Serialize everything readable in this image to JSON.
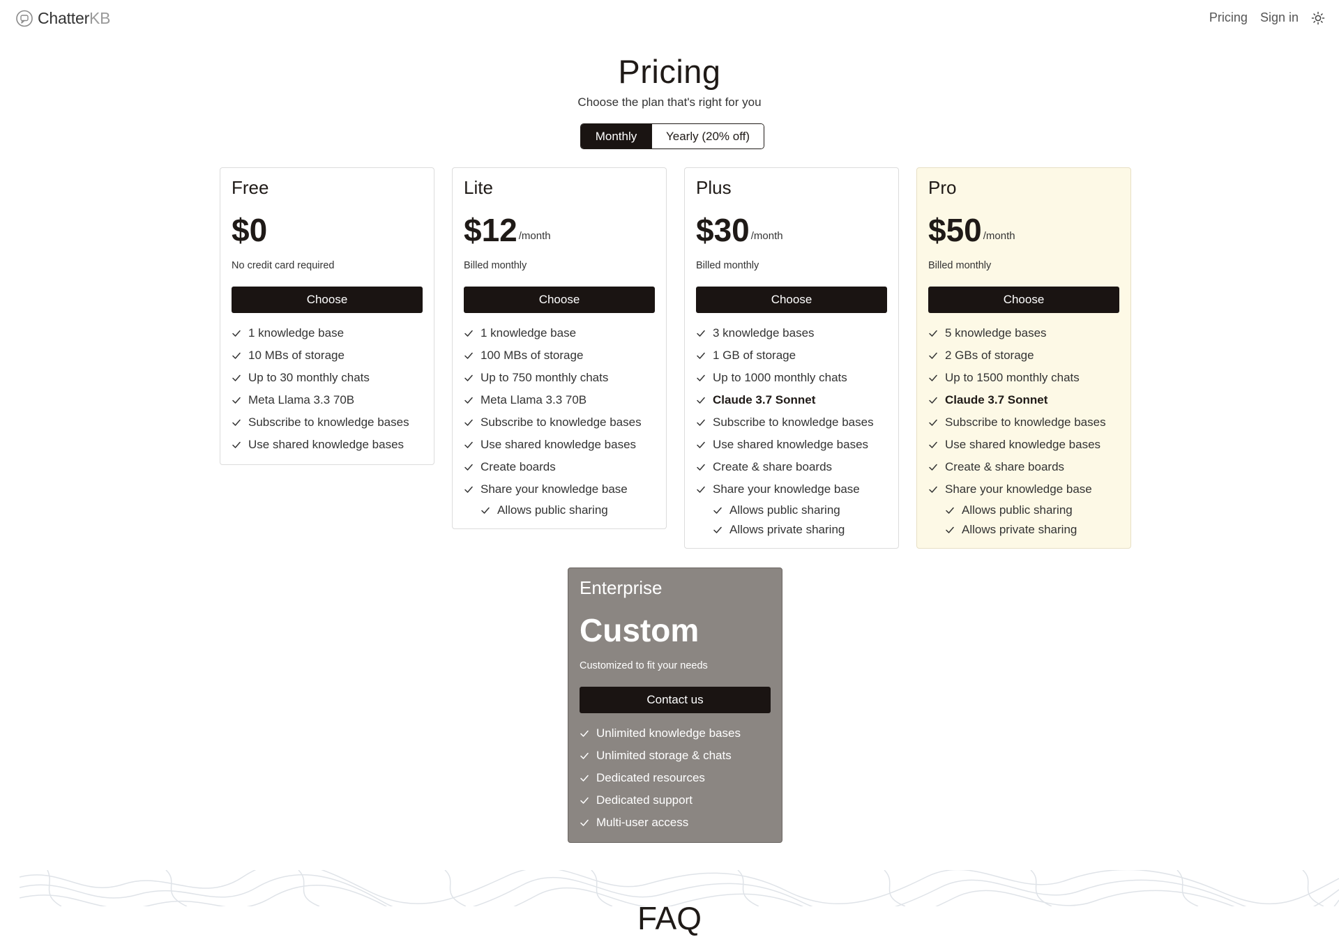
{
  "header": {
    "logo_text_main": "Chatter",
    "logo_text_accent": "KB",
    "nav": {
      "pricing": "Pricing",
      "sign_in": "Sign in"
    },
    "theme_icon": "sun-icon"
  },
  "hero": {
    "title": "Pricing",
    "subtitle": "Choose the plan that's right for you"
  },
  "billing_toggle": {
    "options": [
      "Monthly",
      "Yearly (20% off)"
    ],
    "selected": "Monthly"
  },
  "plans": [
    {
      "name": "Free",
      "price": "$0",
      "period": "",
      "note": "No credit card required",
      "button": "Choose",
      "features": [
        {
          "text": "1 knowledge base"
        },
        {
          "text": "10 MBs of storage"
        },
        {
          "text": "Up to 30 monthly chats"
        },
        {
          "text": "Meta Llama 3.3 70B"
        },
        {
          "text": "Subscribe to knowledge bases"
        },
        {
          "text": "Use shared knowledge bases"
        }
      ]
    },
    {
      "name": "Lite",
      "price": "$12",
      "period": "/month",
      "note": "Billed monthly",
      "button": "Choose",
      "features": [
        {
          "text": "1 knowledge base"
        },
        {
          "text": "100 MBs of storage"
        },
        {
          "text": "Up to 750 monthly chats"
        },
        {
          "text": "Meta Llama 3.3 70B"
        },
        {
          "text": "Subscribe to knowledge bases"
        },
        {
          "text": "Use shared knowledge bases"
        },
        {
          "text": "Create boards"
        },
        {
          "text": "Share your knowledge base"
        },
        {
          "text": "Allows public sharing",
          "sub": true
        }
      ]
    },
    {
      "name": "Plus",
      "price": "$30",
      "period": "/month",
      "note": "Billed monthly",
      "button": "Choose",
      "features": [
        {
          "text": "3 knowledge bases"
        },
        {
          "text": "1 GB of storage"
        },
        {
          "text": "Up to 1000 monthly chats"
        },
        {
          "text": "Claude 3.7 Sonnet",
          "bold": true
        },
        {
          "text": "Subscribe to knowledge bases"
        },
        {
          "text": "Use shared knowledge bases"
        },
        {
          "text": "Create & share boards"
        },
        {
          "text": "Share your knowledge base"
        },
        {
          "text": "Allows public sharing",
          "sub": true
        },
        {
          "text": "Allows private sharing",
          "sub": true
        }
      ]
    },
    {
      "name": "Pro",
      "price": "$50",
      "period": "/month",
      "note": "Billed monthly",
      "button": "Choose",
      "features": [
        {
          "text": "5 knowledge bases"
        },
        {
          "text": "2 GBs of storage"
        },
        {
          "text": "Up to 1500 monthly chats"
        },
        {
          "text": "Claude 3.7 Sonnet",
          "bold": true
        },
        {
          "text": "Subscribe to knowledge bases"
        },
        {
          "text": "Use shared knowledge bases"
        },
        {
          "text": "Create & share boards"
        },
        {
          "text": "Share your knowledge base"
        },
        {
          "text": "Allows public sharing",
          "sub": true
        },
        {
          "text": "Allows private sharing",
          "sub": true
        }
      ]
    }
  ],
  "enterprise": {
    "name": "Enterprise",
    "price": "Custom",
    "note": "Customized to fit your needs",
    "button": "Contact us",
    "features": [
      {
        "text": "Unlimited knowledge bases"
      },
      {
        "text": "Unlimited storage & chats"
      },
      {
        "text": "Dedicated resources"
      },
      {
        "text": "Dedicated support"
      },
      {
        "text": "Multi-user access"
      }
    ]
  },
  "faq": {
    "title": "FAQ"
  },
  "colors": {
    "primary_button": "#1a1412",
    "pro_card_bg": "#fdf9e6",
    "enterprise_card_bg": "#8b8682"
  }
}
